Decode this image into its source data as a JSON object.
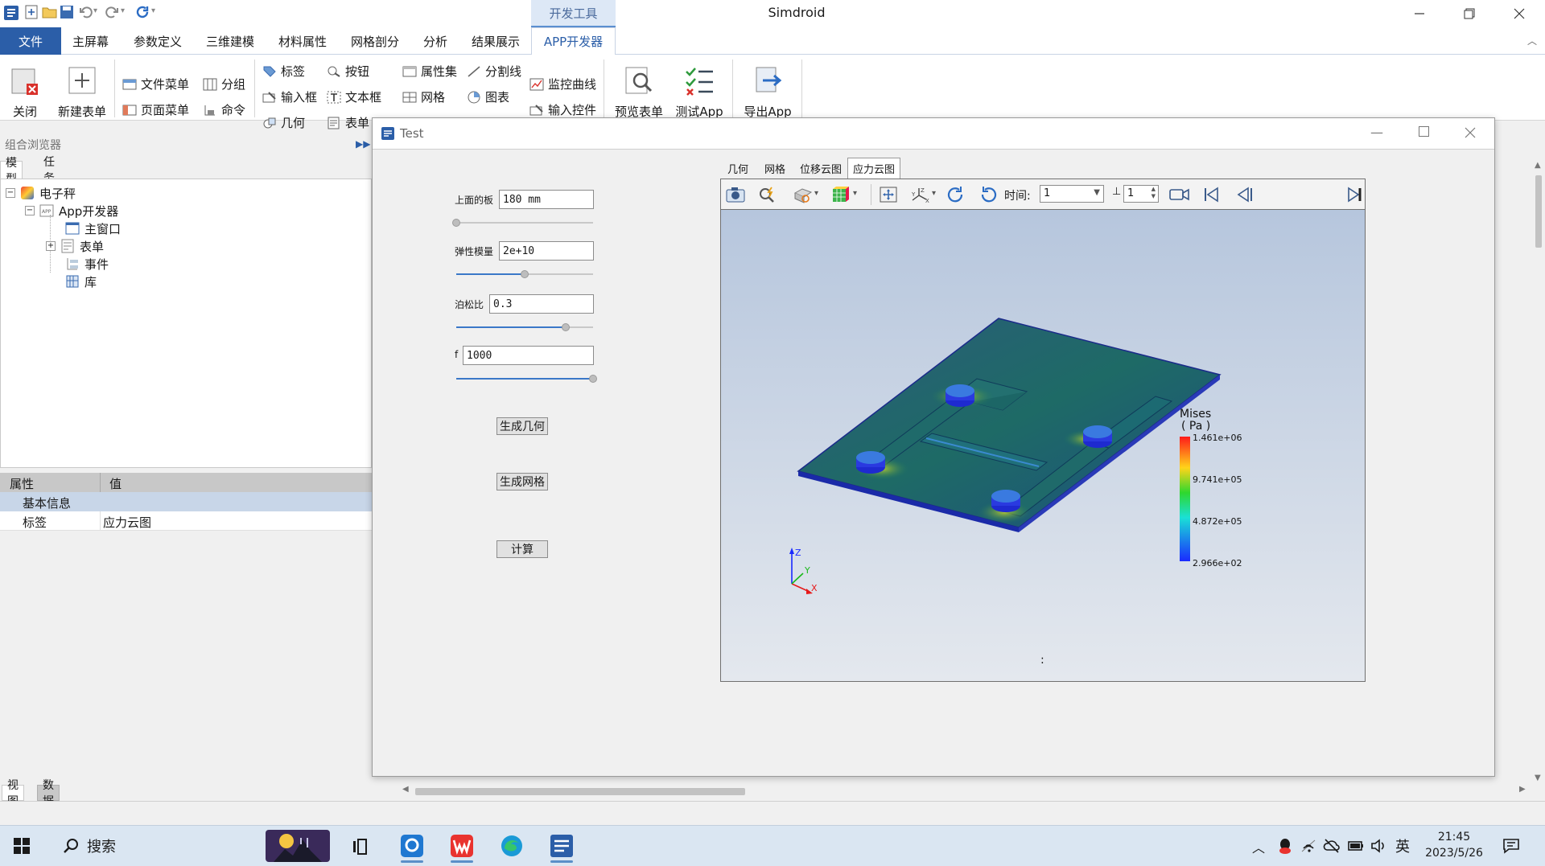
{
  "window": {
    "title": "Simdroid",
    "context_tab": "开发工具"
  },
  "menu": {
    "items": [
      "文件",
      "主屏幕",
      "参数定义",
      "三维建模",
      "材料属性",
      "网格剖分",
      "分析",
      "结果展示",
      "APP开发器"
    ]
  },
  "ribbon": {
    "close": "关闭",
    "new_form": "新建表单",
    "file_menu": "文件菜单",
    "page_menu": "页面菜单",
    "group": "分组",
    "command": "命令",
    "label": "标签",
    "input_box": "输入框",
    "geometry": "几何",
    "button": "按钮",
    "text_box": "文本框",
    "form": "表单",
    "property_set": "属性集",
    "mesh": "网格",
    "separator": "分割线",
    "chart": "图表",
    "monitor_curve": "监控曲线",
    "input_control": "输入控件",
    "preview_form": "预览表单",
    "test_app": "测试App",
    "export_app": "导出App"
  },
  "browser": {
    "header": "组合浏览器",
    "tab_model": "模型",
    "tab_task": "任务",
    "tree": {
      "root": "电子秤",
      "app": "App开发器",
      "main_window": "主窗口",
      "form": "表单",
      "event": "事件",
      "library": "库"
    }
  },
  "properties": {
    "col_prop": "属性",
    "col_value": "值",
    "group": "基本信息",
    "row_name": "标签",
    "row_value": "应力云图"
  },
  "bottom_tabs": {
    "view": "视图",
    "data": "数据"
  },
  "dialog": {
    "title": "Test",
    "params": {
      "plate_label": "上面的板",
      "plate_value": "180 mm",
      "plate_slider": 0.0,
      "modulus_label": "弹性模量",
      "modulus_value": "2e+10",
      "modulus_slider": 0.5,
      "poisson_label": "泊松比",
      "poisson_value": "0.3",
      "poisson_slider": 0.8,
      "f_label": "f",
      "f_value": "1000",
      "f_slider": 1.0
    },
    "buttons": {
      "gen_geometry": "生成几何",
      "gen_mesh": "生成网格",
      "compute": "计算"
    },
    "viewer": {
      "tabs": [
        "几何",
        "网格",
        "位移云图",
        "应力云图"
      ],
      "active_tab": "应力云图",
      "time_label": "时间:",
      "time_value": "1",
      "step_value": "1",
      "footer_text": ":",
      "legend": {
        "title_line1": "Mises",
        "title_line2": "( Pa )",
        "max": "1.461e+06",
        "mid1": "9.741e+05",
        "mid2": "4.872e+05",
        "min": "2.966e+02"
      },
      "axes": {
        "x": "X",
        "y": "Y",
        "z": "Z"
      }
    }
  },
  "taskbar": {
    "search": "搜索",
    "ime": "英",
    "time": "21:45",
    "date": "2023/5/26"
  },
  "colors": {
    "accent": "#2b5ea8",
    "legend_max": "#ff1a1a",
    "legend_min": "#1a2aff"
  }
}
